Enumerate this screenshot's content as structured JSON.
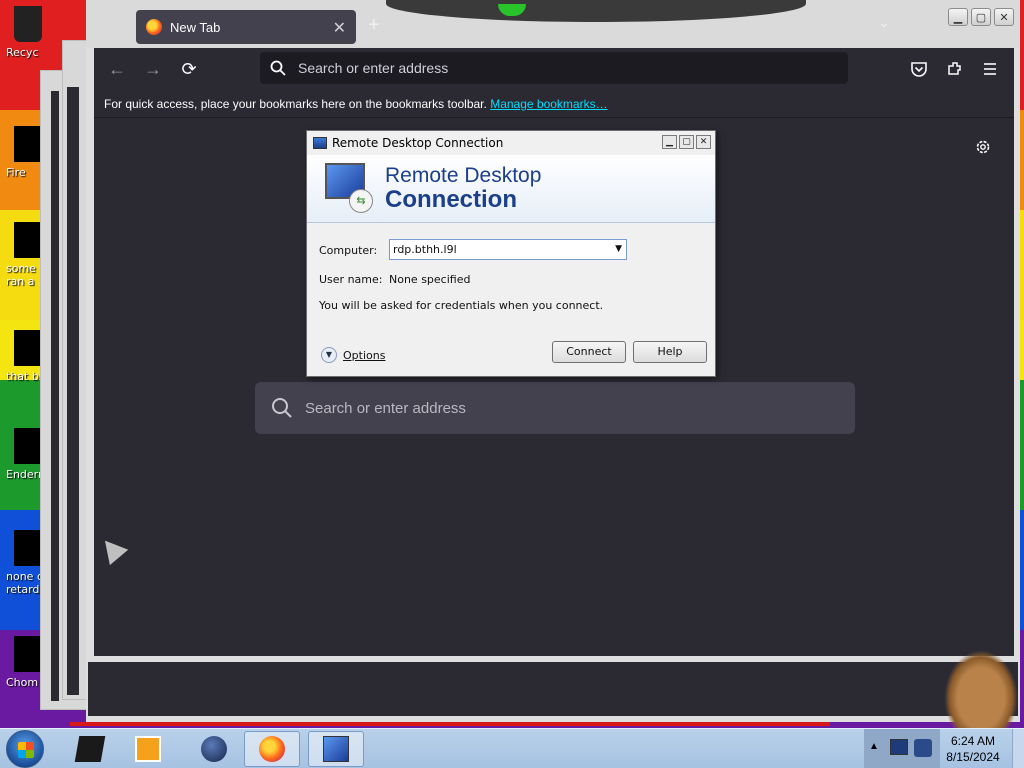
{
  "desktop": {
    "icons": [
      {
        "label_lines": [
          "Recyc"
        ]
      },
      {
        "label_lines": [
          "Fire"
        ]
      },
      {
        "label_lines": [
          "some r",
          "ran a"
        ]
      },
      {
        "label_lines": [
          "that bu"
        ]
      },
      {
        "label_lines": [
          "Enderm"
        ]
      },
      {
        "label_lines": [
          "none o",
          "retards"
        ]
      },
      {
        "label_lines": [
          "Chom"
        ]
      }
    ]
  },
  "browser": {
    "tab": {
      "title": "New Tab",
      "close": "✕"
    },
    "new_tab": "+",
    "window_buttons": [
      "▁",
      "▢",
      "✕"
    ],
    "nav": {
      "back": "←",
      "forward": "→",
      "reload": "⟳"
    },
    "urlbar": {
      "placeholder": "Search or enter address",
      "icon": "search-icon"
    },
    "toolbar_icons": [
      "pocket-icon",
      "extensions-icon",
      "menu-icon"
    ],
    "bookmarks_bar": {
      "text": "For quick access, place your bookmarks here on the bookmarks toolbar.",
      "link": "Manage bookmarks…"
    },
    "new_tab_page": {
      "search_placeholder": "Search or enter address",
      "settings_icon": "gear-icon"
    }
  },
  "rdc_dialog": {
    "title": "Remote Desktop Connection",
    "banner_line1": "Remote Desktop",
    "banner_line2": "Connection",
    "computer_label": "Computer:",
    "computer_value": "rdp.bthh.l9l",
    "username_label": "User name:",
    "username_value": "None specified",
    "note": "You will be asked for credentials when you connect.",
    "options_label": "Options",
    "connect_label": "Connect",
    "help_label": "Help",
    "window_buttons": [
      "▁",
      "▢",
      "✕"
    ]
  },
  "taskbar": {
    "items": [
      "start-button",
      "app-black-box",
      "media-player",
      "globe-app",
      "firefox",
      "remote-desktop"
    ],
    "active_item": "remote-desktop",
    "clock": {
      "time": "6:24 AM",
      "date": "8/15/2024"
    }
  }
}
